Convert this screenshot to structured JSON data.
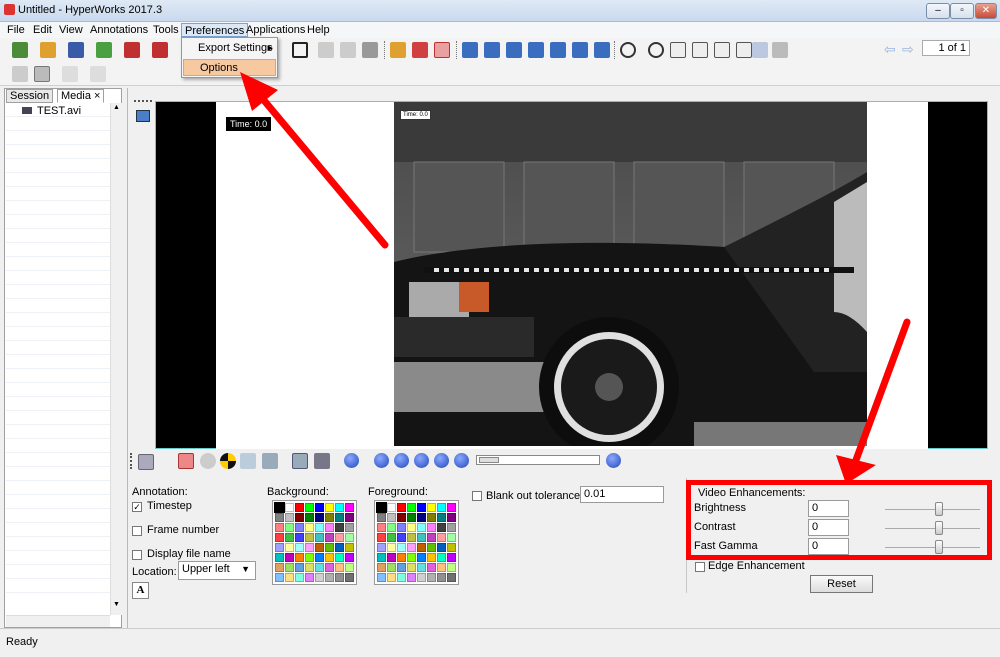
{
  "window": {
    "title": "Untitled - HyperWorks 2017.3",
    "controls": [
      "minimize",
      "maximize",
      "close"
    ]
  },
  "menubar": {
    "items": [
      "File",
      "Edit",
      "View",
      "Annotations",
      "Tools",
      "Preferences",
      "Applications",
      "Help"
    ],
    "active": "Preferences"
  },
  "preferences_menu": {
    "items": [
      "Export Settings",
      "Options"
    ],
    "highlighted": "Options"
  },
  "toolbar": {
    "page": "1 of 1"
  },
  "left_panel": {
    "tabs": [
      "Session",
      "Media"
    ],
    "active_tab": "Media",
    "close_glyph": "×",
    "files": [
      "TEST.avi"
    ]
  },
  "viewer": {
    "timestamp_large": "Time: 0.0",
    "timestamp_small": "Time: 0.0"
  },
  "annotation": {
    "heading": "Annotation:",
    "timestep": {
      "label": "Timestep",
      "checked": true
    },
    "frame_number": {
      "label": "Frame number",
      "checked": false
    },
    "display_file_name": {
      "label": "Display file name",
      "checked": false
    },
    "location_label": "Location:",
    "location_value": "Upper left",
    "font_button": "A"
  },
  "background": {
    "label": "Background:"
  },
  "foreground": {
    "label": "Foreground:"
  },
  "blank_out": {
    "label": "Blank out tolerance",
    "checked": false,
    "value": "0.01"
  },
  "video_enhancements": {
    "heading": "Video Enhancements:",
    "brightness": {
      "label": "Brightness",
      "value": "0"
    },
    "contrast": {
      "label": "Contrast",
      "value": "0"
    },
    "fast_gamma": {
      "label": "Fast Gamma",
      "value": "0"
    },
    "edge_enhancement": {
      "label": "Edge Enhancement",
      "checked": false
    },
    "reset": "Reset"
  },
  "status": {
    "text": "Ready"
  },
  "colors": {
    "highlight": "#ff0000",
    "menu_highlight": "#f6c9a0"
  },
  "palette": [
    "#000000",
    "#ffffff",
    "#ff0000",
    "#00ff00",
    "#0000ff",
    "#ffff00",
    "#00ffff",
    "#ff00ff",
    "#808080",
    "#c0c0c0",
    "#800000",
    "#008000",
    "#000080",
    "#808000",
    "#008080",
    "#800080",
    "#ff8080",
    "#80ff80",
    "#8080ff",
    "#ffff80",
    "#80ffff",
    "#ff80ff",
    "#404040",
    "#a0a0a0",
    "#ff4040",
    "#40c040",
    "#4040ff",
    "#c0c040",
    "#40c0c0",
    "#c040c0",
    "#ffa0a0",
    "#a0ffa0",
    "#a0a0ff",
    "#ffffa0",
    "#a0ffff",
    "#ffa0ff",
    "#c06000",
    "#60c000",
    "#0060c0",
    "#c0c000",
    "#00c0c0",
    "#c000c0",
    "#ff8000",
    "#80ff00",
    "#0080ff",
    "#ffc000",
    "#00ffc0",
    "#c000ff",
    "#e0a060",
    "#a0e060",
    "#60a0e0",
    "#e0e060",
    "#60e0e0",
    "#e060e0",
    "#ffc080",
    "#c0ff80",
    "#80c0ff",
    "#ffe080",
    "#80ffe0",
    "#e080ff",
    "#d0d0d0",
    "#b0b0b0",
    "#909090",
    "#707070"
  ]
}
